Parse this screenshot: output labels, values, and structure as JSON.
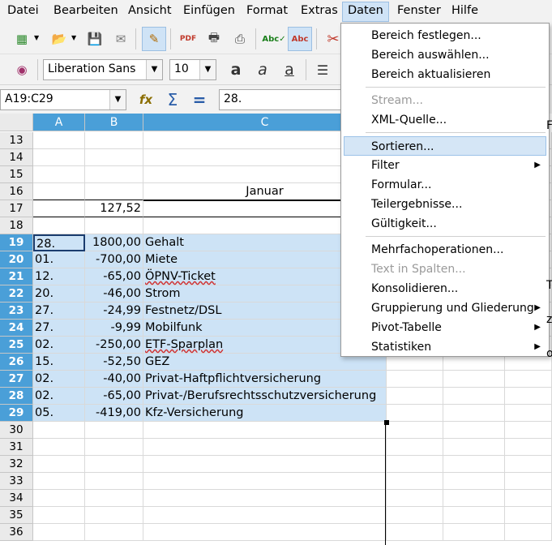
{
  "menubar": [
    "Datei",
    "Bearbeiten",
    "Ansicht",
    "Einfügen",
    "Format",
    "Extras",
    "Daten",
    "Fenster",
    "Hilfe"
  ],
  "font_name": "Liberation Sans",
  "font_size": "10",
  "name_box": "A19:C29",
  "formula_value": "28.",
  "columns": [
    "A",
    "B",
    "C"
  ],
  "rows": [
    {
      "n": "13",
      "a": "",
      "b": "",
      "c": ""
    },
    {
      "n": "14",
      "a": "",
      "b": "",
      "c": ""
    },
    {
      "n": "15",
      "a": "",
      "b": "",
      "c": ""
    },
    {
      "n": "16",
      "a": "",
      "b": "",
      "c": "Januar"
    },
    {
      "n": "17",
      "a": "",
      "b": "127,52",
      "c": ""
    },
    {
      "n": "18",
      "a": "",
      "b": "",
      "c": ""
    },
    {
      "n": "19",
      "a": "28.",
      "b": "1800,00",
      "c": "Gehalt"
    },
    {
      "n": "20",
      "a": "01.",
      "b": "-700,00",
      "c": "Miete"
    },
    {
      "n": "21",
      "a": "12.",
      "b": "-65,00",
      "c": "ÖPNV-Ticket"
    },
    {
      "n": "22",
      "a": "20.",
      "b": "-46,00",
      "c": "Strom"
    },
    {
      "n": "23",
      "a": "27.",
      "b": "-24,99",
      "c": "Festnetz/DSL"
    },
    {
      "n": "24",
      "a": "27.",
      "b": "-9,99",
      "c": "Mobilfunk"
    },
    {
      "n": "25",
      "a": "02.",
      "b": "-250,00",
      "c": "ETF-Sparplan"
    },
    {
      "n": "26",
      "a": "15.",
      "b": "-52,50",
      "c": "GEZ"
    },
    {
      "n": "27",
      "a": "02.",
      "b": "-40,00",
      "c": "Privat-Haftpflichtversicherung"
    },
    {
      "n": "28",
      "a": "02.",
      "b": "-65,00",
      "c": "Privat-/Berufsrechtsschutzversicherung"
    },
    {
      "n": "29",
      "a": "05.",
      "b": "-419,00",
      "c": "Kfz-Versicherung"
    },
    {
      "n": "30",
      "a": "",
      "b": "",
      "c": ""
    },
    {
      "n": "31",
      "a": "",
      "b": "",
      "c": ""
    },
    {
      "n": "32",
      "a": "",
      "b": "",
      "c": ""
    },
    {
      "n": "33",
      "a": "",
      "b": "",
      "c": ""
    },
    {
      "n": "34",
      "a": "",
      "b": "",
      "c": ""
    },
    {
      "n": "35",
      "a": "",
      "b": "",
      "c": ""
    },
    {
      "n": "36",
      "a": "",
      "b": "",
      "c": ""
    }
  ],
  "right_col_fragments": [
    "Fi",
    "T",
    "z",
    "o"
  ],
  "daten_menu": [
    {
      "label": "Bereich festlegen...",
      "disabled": false,
      "sub": false
    },
    {
      "label": "Bereich auswählen...",
      "disabled": false,
      "sub": false
    },
    {
      "label": "Bereich aktualisieren",
      "disabled": false,
      "sub": false
    },
    {
      "sep": true
    },
    {
      "label": "Stream...",
      "disabled": true,
      "sub": false
    },
    {
      "label": "XML-Quelle...",
      "disabled": false,
      "sub": false
    },
    {
      "sep": true
    },
    {
      "label": "Sortieren...",
      "disabled": false,
      "sub": false,
      "hover": true
    },
    {
      "label": "Filter",
      "disabled": false,
      "sub": true
    },
    {
      "label": "Formular...",
      "disabled": false,
      "sub": false
    },
    {
      "label": "Teilergebnisse...",
      "disabled": false,
      "sub": false
    },
    {
      "label": "Gültigkeit...",
      "disabled": false,
      "sub": false
    },
    {
      "sep": true
    },
    {
      "label": "Mehrfachoperationen...",
      "disabled": false,
      "sub": false
    },
    {
      "label": "Text in Spalten...",
      "disabled": true,
      "sub": false
    },
    {
      "label": "Konsolidieren...",
      "disabled": false,
      "sub": false
    },
    {
      "label": "Gruppierung und Gliederung",
      "disabled": false,
      "sub": true
    },
    {
      "label": "Pivot-Tabelle",
      "disabled": false,
      "sub": true
    },
    {
      "label": "Statistiken",
      "disabled": false,
      "sub": true
    }
  ]
}
